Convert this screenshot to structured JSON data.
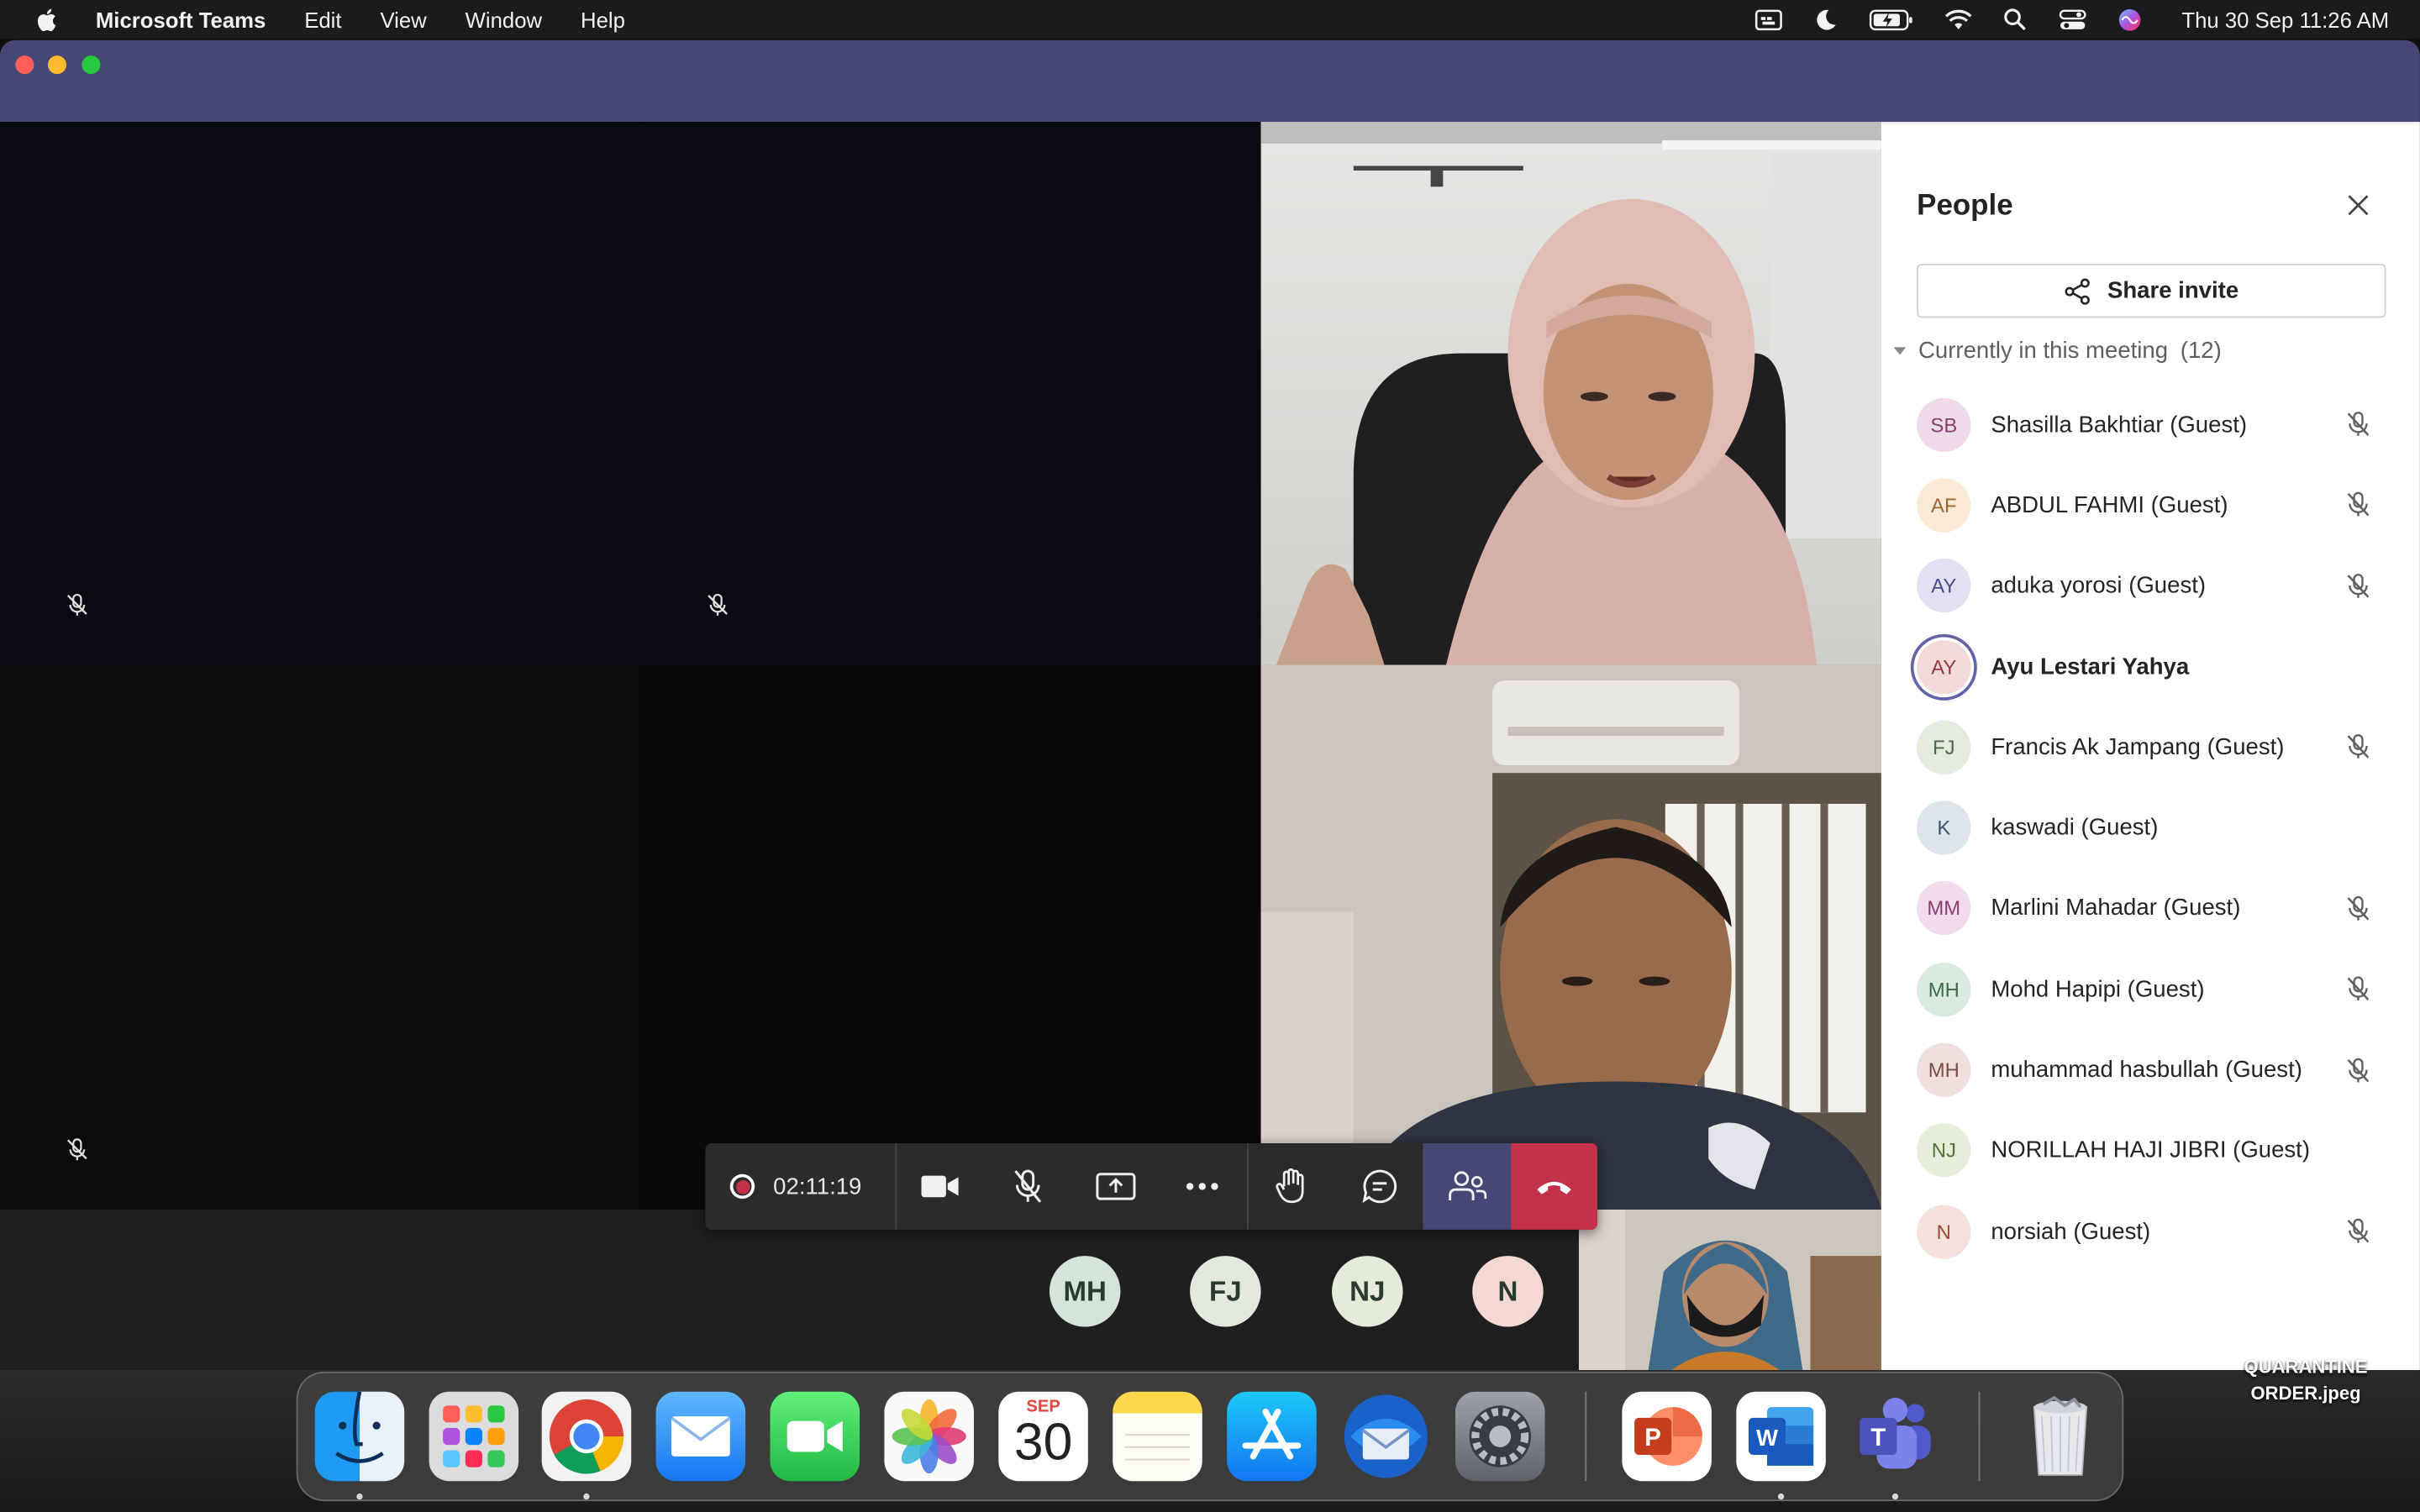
{
  "menubar": {
    "app_name": "Microsoft Teams",
    "items": [
      "Edit",
      "View",
      "Window",
      "Help"
    ],
    "clock": "Thu 30 Sep  11:26 AM"
  },
  "meeting": {
    "timer": "02:11:19",
    "strip_avatars": [
      {
        "initials": "MH",
        "color": "#d5e4d8"
      },
      {
        "initials": "FJ",
        "color": "#e3e8dc"
      },
      {
        "initials": "NJ",
        "color": "#e4ecd9"
      },
      {
        "initials": "N",
        "color": "#f4d9d3"
      }
    ]
  },
  "people_panel": {
    "title": "People",
    "share_label": "Share invite",
    "section_label": "Currently in this meeting",
    "section_count": "(12)",
    "participants": [
      {
        "initials": "SB",
        "name": "Shasilla Bakhtiar (Guest)",
        "muted": true,
        "color": "#efdbe8",
        "text_color": "#8a3f6f"
      },
      {
        "initials": "AF",
        "name": "ABDUL FAHMI (Guest)",
        "muted": true,
        "color": "#fbe9d7",
        "text_color": "#9b6a2e"
      },
      {
        "initials": "AY",
        "name": "aduka yorosi (Guest)",
        "muted": true,
        "color": "#e2e1f2",
        "text_color": "#4d4a8a"
      },
      {
        "initials": "AY",
        "name": "Ayu Lestari Yahya",
        "muted": false,
        "active": true,
        "color": "#f3dada",
        "text_color": "#9a3b3b"
      },
      {
        "initials": "FJ",
        "name": "Francis Ak Jampang (Guest)",
        "muted": true,
        "color": "#e4ebdf",
        "text_color": "#4f6a3e"
      },
      {
        "initials": "K",
        "name": "kaswadi (Guest)",
        "muted": false,
        "color": "#dde4ea",
        "text_color": "#3d5467"
      },
      {
        "initials": "MM",
        "name": "Marlini Mahadar (Guest)",
        "muted": true,
        "color": "#f2dbeb",
        "text_color": "#8a3f73"
      },
      {
        "initials": "MH",
        "name": "Mohd Hapipi (Guest)",
        "muted": true,
        "color": "#dbeadf",
        "text_color": "#3e6b4a"
      },
      {
        "initials": "MH",
        "name": "muhammad hasbullah (Guest)",
        "muted": true,
        "color": "#efe0dd",
        "text_color": "#7a4f46"
      },
      {
        "initials": "NJ",
        "name": "NORILLAH HAJI JIBRI (Guest)",
        "muted": false,
        "color": "#e6eedb",
        "text_color": "#56713a"
      },
      {
        "initials": "N",
        "name": "norsiah (Guest)",
        "muted": true,
        "color": "#f6e0db",
        "text_color": "#9a4a3a"
      }
    ]
  },
  "dock": {
    "calendar_month": "SEP",
    "calendar_day": "30",
    "apps": [
      "Finder",
      "Launchpad",
      "Google Chrome",
      "Mail",
      "FaceTime",
      "Photos",
      "Calendar",
      "Notes",
      "App Store",
      "Thunderbird",
      "System Preferences",
      "Microsoft PowerPoint",
      "Microsoft Word",
      "Microsoft Teams",
      "Trash"
    ]
  },
  "desktop": {
    "file_line1": "QUARANTINE",
    "file_line2": "ORDER.jpeg"
  },
  "colors": {
    "teams_titlebar": "#464775",
    "hangup": "#c4314b",
    "record_dot": "#c4314b"
  }
}
